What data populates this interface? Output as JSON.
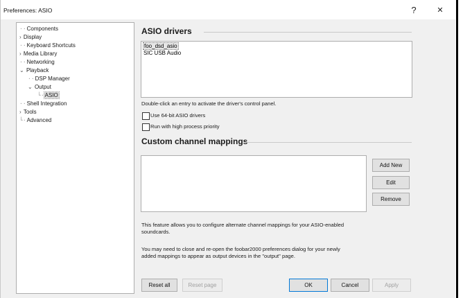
{
  "window": {
    "title": "Preferences: ASIO",
    "help_label": "?",
    "close_label": "✕"
  },
  "tree": {
    "items": [
      {
        "label": "Components"
      },
      {
        "label": "Display"
      },
      {
        "label": "Keyboard Shortcuts"
      },
      {
        "label": "Media Library"
      },
      {
        "label": "Networking"
      },
      {
        "label": "Playback"
      },
      {
        "label": "DSP Manager"
      },
      {
        "label": "Output"
      },
      {
        "label": "ASIO"
      },
      {
        "label": "Shell Integration"
      },
      {
        "label": "Tools"
      },
      {
        "label": "Advanced"
      }
    ]
  },
  "asio": {
    "heading": "ASIO drivers",
    "drivers": [
      "foo_dsd_asio",
      "SIC USB Audio"
    ],
    "hint": "Double-click an entry to activate the driver's control panel.",
    "use64_label": "Use 64-bit ASIO drivers",
    "high_priority_label": "Run with high process priority"
  },
  "mappings": {
    "heading": "Custom channel mappings",
    "add_new": "Add New",
    "edit": "Edit",
    "remove": "Remove",
    "info1": "This feature allows you to configure alternate channel mappings for your ASIO-enabled",
    "info1b": "soundcards.",
    "info2": "You may need to close and re-open the foobar2000 preferences dialog for your newly",
    "info2b": "added mappings to appear as output devices in the \"output\" page."
  },
  "footer": {
    "reset_all": "Reset all",
    "reset_page": "Reset page",
    "ok": "OK",
    "cancel": "Cancel",
    "apply": "Apply"
  }
}
